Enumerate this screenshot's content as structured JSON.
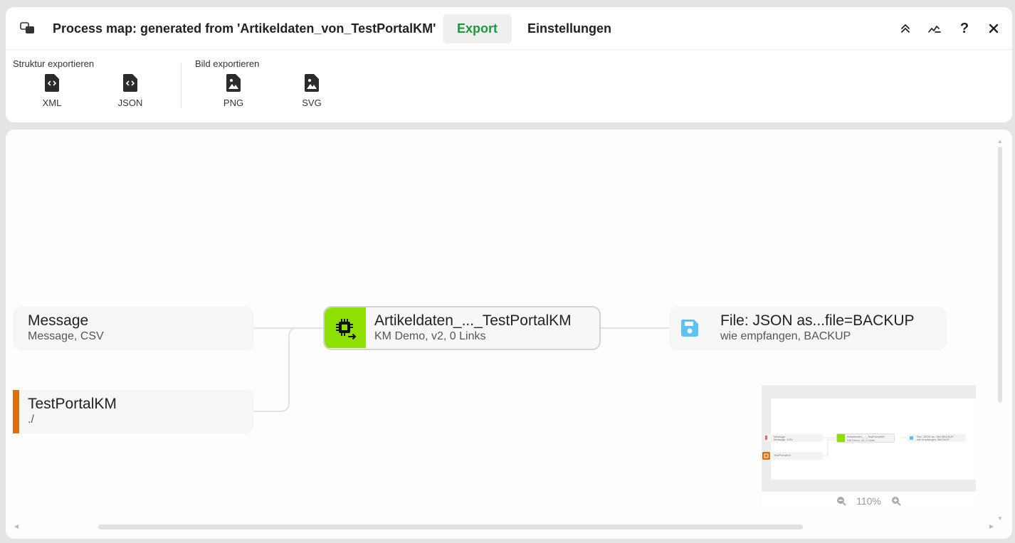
{
  "header": {
    "title": "Process map: generated from 'Artikeldaten_von_TestPortalKM'",
    "tabs": [
      {
        "label": "Export",
        "active": true
      },
      {
        "label": "Einstellungen",
        "active": false
      }
    ],
    "help_label": "?",
    "icons": [
      "collapse-up-icon",
      "chart-line-icon",
      "help-icon",
      "close-icon"
    ]
  },
  "export": {
    "structure_label": "Struktur exportieren",
    "image_label": "Bild exportieren",
    "structure_buttons": [
      {
        "label": "XML",
        "icon": "code-file-icon"
      },
      {
        "label": "JSON",
        "icon": "code-file-icon"
      }
    ],
    "image_buttons": [
      {
        "label": "PNG",
        "icon": "image-file-icon"
      },
      {
        "label": "SVG",
        "icon": "image-file-icon"
      }
    ]
  },
  "nodes": {
    "message": {
      "title": "Message",
      "subtitle": "Message, CSV"
    },
    "portal": {
      "title": "TestPortalKM",
      "subtitle": "./",
      "accent": "#d97012"
    },
    "center": {
      "title": "Artikeldaten_..._TestPortalKM",
      "subtitle": "KM Demo, v2, 0 Links",
      "accent": "#8ee000"
    },
    "file": {
      "title": "File: JSON as...file=BACKUP",
      "subtitle": "wie empfangen, BACKUP",
      "icon_color": "#5bc2f2"
    }
  },
  "minimap": {
    "zoom": "110%",
    "nodes": {
      "message_title": "Message",
      "message_sub": "Message, CSV",
      "portal_title": "TestPortalKM",
      "center_title": "Artikeldaten_..._TestPortalKM",
      "center_sub": "KM Demo, v2, 0 Links",
      "file_title": "File: JSON as...file=BACKUP",
      "file_sub": "wie empfangen, BACKUP"
    }
  },
  "colors": {
    "accent_green": "#1a9a3c",
    "processor_green": "#8ee000",
    "portal_orange": "#d97012",
    "file_blue": "#5bc2f2"
  }
}
